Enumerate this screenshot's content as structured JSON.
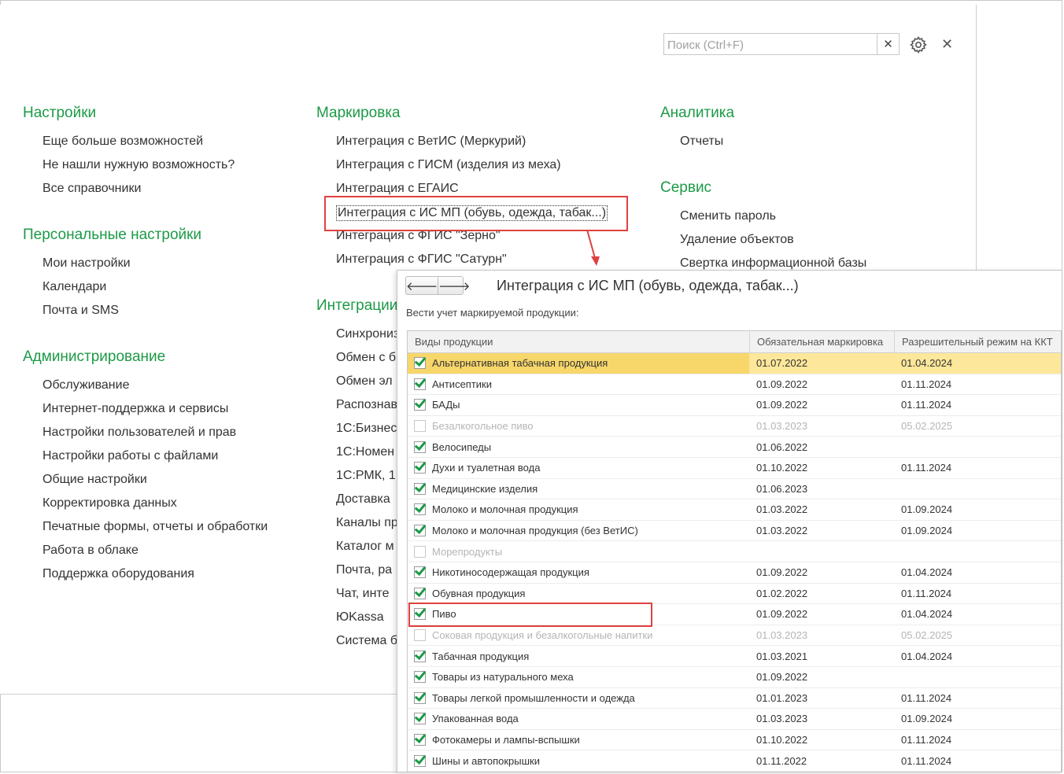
{
  "search": {
    "placeholder": "Поиск (Ctrl+F)",
    "clear_icon": "close-icon"
  },
  "toolbar": {
    "settings_icon": "gear-icon",
    "close_icon": "close-icon"
  },
  "columns": [
    {
      "title": "Настройки",
      "items": [
        "Еще больше возможностей",
        "Не нашли нужную возможность?",
        "Все справочники"
      ]
    },
    {
      "title": "Персональные настройки",
      "items": [
        "Мои настройки",
        "Календари",
        "Почта и SMS"
      ]
    },
    {
      "title": "Администрирование",
      "items": [
        "Обслуживание",
        "Интернет-поддержка и сервисы",
        "Настройки пользователей и прав",
        "Настройки работы с файлами",
        "Общие настройки",
        "Корректировка данных",
        "Печатные формы, отчеты и обработки",
        "Работа в облаке",
        "Поддержка оборудования"
      ]
    }
  ],
  "marking": {
    "title": "Маркировка",
    "items": [
      "Интеграция с ВетИС (Меркурий)",
      "Интеграция с ГИСМ (изделия из меха)",
      "Интеграция с ЕГАИС",
      "Интеграция с ИС МП (обувь, одежда, табак...)",
      "Интеграция с ФГИС \"Зерно\"",
      "Интеграция с ФГИС \"Сатурн\""
    ]
  },
  "integration": {
    "title": "Интеграции",
    "items": [
      "Синхрониз",
      "Обмен с б",
      "Обмен эл",
      "Распознав",
      "1С:Бизнес",
      "1С:Номен",
      "1С:РМК, 1",
      "Доставка",
      "Каналы пр",
      "Каталог м",
      "Почта, ра",
      "Чат, инте",
      "ЮKassa",
      "Система б"
    ]
  },
  "analytics": {
    "title": "Аналитика",
    "items": [
      "Отчеты"
    ]
  },
  "service": {
    "title": "Сервис",
    "items": [
      "Сменить пароль",
      "Удаление объектов",
      "Свертка информационной базы"
    ]
  },
  "popup": {
    "back_icon": "arrow-left-icon",
    "forward_icon": "arrow-right-icon",
    "back_glyph": "🡐",
    "forward_glyph": "🡒",
    "title": "Интеграция с ИС МП (обувь, одежда, табак...)",
    "label": "Вести учет маркируемой продукции:",
    "headers": [
      "Виды продукции",
      "Обязательная маркировка",
      "Разрешительный режим на ККТ"
    ],
    "rows": [
      {
        "name": "Альтернативная табачная продукция",
        "mandatory": "01.07.2022",
        "permit": "01.04.2024",
        "checked": true,
        "selected": true
      },
      {
        "name": "Антисептики",
        "mandatory": "01.09.2022",
        "permit": "01.11.2024",
        "checked": true
      },
      {
        "name": "БАДы",
        "mandatory": "01.09.2022",
        "permit": "01.11.2024",
        "checked": true
      },
      {
        "name": "Безалкогольное пиво",
        "mandatory": "01.03.2023",
        "permit": "05.02.2025",
        "checked": false
      },
      {
        "name": "Велосипеды",
        "mandatory": "01.06.2022",
        "permit": "",
        "checked": true
      },
      {
        "name": "Духи и туалетная вода",
        "mandatory": "01.10.2022",
        "permit": "01.11.2024",
        "checked": true
      },
      {
        "name": "Медицинские изделия",
        "mandatory": "01.06.2023",
        "permit": "",
        "checked": true
      },
      {
        "name": "Молоко и молочная продукция",
        "mandatory": "01.03.2022",
        "permit": "01.09.2024",
        "checked": true
      },
      {
        "name": "Молоко и молочная продукция (без ВетИС)",
        "mandatory": "01.03.2022",
        "permit": "01.09.2024",
        "checked": true
      },
      {
        "name": "Морепродукты",
        "mandatory": "",
        "permit": "",
        "checked": false
      },
      {
        "name": "Никотиносодержащая продукция",
        "mandatory": "01.09.2022",
        "permit": "01.04.2024",
        "checked": true
      },
      {
        "name": "Обувная продукция",
        "mandatory": "01.02.2022",
        "permit": "01.11.2024",
        "checked": true
      },
      {
        "name": "Пиво",
        "mandatory": "01.09.2022",
        "permit": "01.04.2024",
        "checked": true
      },
      {
        "name": "Соковая продукция и безалкогольные напитки",
        "mandatory": "01.03.2023",
        "permit": "05.02.2025",
        "checked": false
      },
      {
        "name": "Табачная продукция",
        "mandatory": "01.03.2021",
        "permit": "01.04.2024",
        "checked": true
      },
      {
        "name": "Товары из натурального меха",
        "mandatory": "01.09.2022",
        "permit": "",
        "checked": true
      },
      {
        "name": "Товары легкой промышленности и одежда",
        "mandatory": "01.01.2023",
        "permit": "01.11.2024",
        "checked": true
      },
      {
        "name": "Упакованная вода",
        "mandatory": "01.03.2023",
        "permit": "01.09.2024",
        "checked": true
      },
      {
        "name": "Фотокамеры и лампы-вспышки",
        "mandatory": "01.10.2022",
        "permit": "01.11.2024",
        "checked": true
      },
      {
        "name": "Шины и автопокрышки",
        "mandatory": "01.11.2022",
        "permit": "01.11.2024",
        "checked": true
      }
    ]
  },
  "colors": {
    "section_title": "#1c9a47",
    "highlight": "#e04040",
    "selected_row": "#fde79a",
    "checkmark": "#1c9a47"
  }
}
